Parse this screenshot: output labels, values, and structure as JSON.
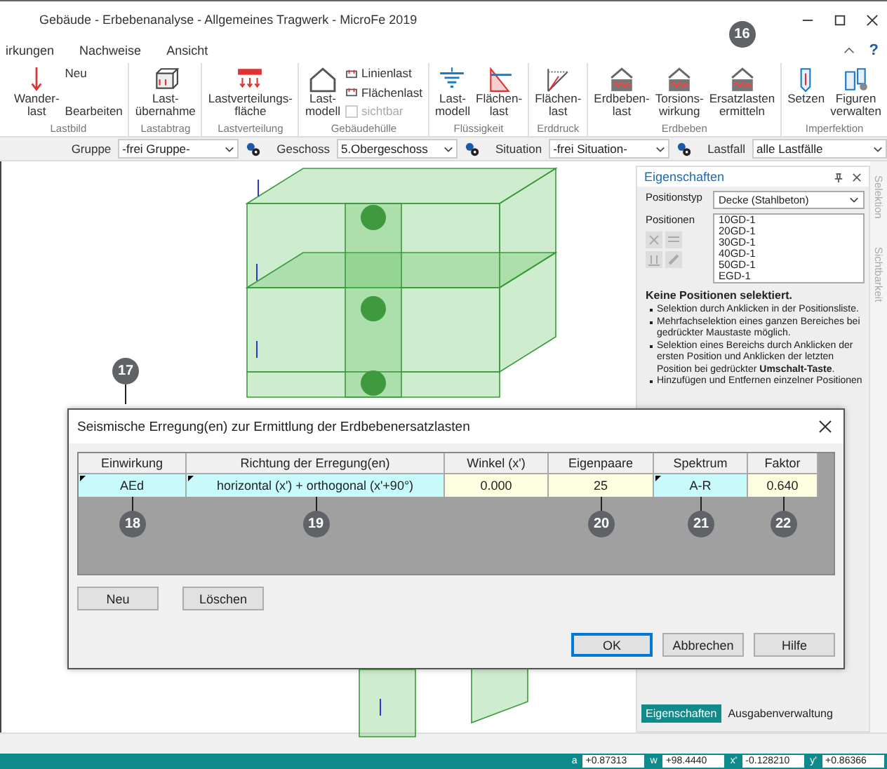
{
  "window": {
    "title": "Gebäude - Erbebenanalyse - Allgemeines Tragwerk - MicroFe 2019"
  },
  "menu": [
    "irkungen",
    "Nachweise",
    "Ansicht"
  ],
  "help": "?",
  "ribbon": [
    {
      "label": "Lastbild",
      "buttons": [
        {
          "kind": "large",
          "label": "Wander-\nlast"
        },
        {
          "kind": "stack",
          "items": [
            {
              "kind": "small",
              "label": "Neu"
            },
            {
              "kind": "small",
              "label": "Bearbeiten"
            }
          ]
        }
      ]
    },
    {
      "label": "Lastabtrag",
      "buttons": [
        {
          "kind": "large",
          "label": "Last-\nübernahme"
        }
      ]
    },
    {
      "label": "Lastverteilung",
      "buttons": [
        {
          "kind": "large",
          "label": "Lastverteilungs-\nfläche"
        }
      ]
    },
    {
      "label": "Gebäudehülle",
      "buttons": [
        {
          "kind": "large",
          "label": "Last-\nmodell"
        },
        {
          "kind": "stack",
          "items": [
            {
              "kind": "tool",
              "label": "Linienlast"
            },
            {
              "kind": "tool",
              "label": "Flächenlast"
            },
            {
              "kind": "check",
              "label": "sichtbar",
              "checked": false,
              "disabled": true
            }
          ]
        }
      ]
    },
    {
      "label": "Flüssigkeit",
      "buttons": [
        {
          "kind": "large",
          "label": "Last-\nmodell"
        },
        {
          "kind": "large",
          "label": "Flächen-\nlast"
        }
      ]
    },
    {
      "label": "Erddruck",
      "buttons": [
        {
          "kind": "large",
          "label": "Flächen-\nlast"
        }
      ]
    },
    {
      "label": "Erdbeben",
      "buttons": [
        {
          "kind": "large",
          "label": "Erdbeben-\nlast"
        },
        {
          "kind": "large",
          "label": "Torsions-\nwirkung"
        },
        {
          "kind": "large",
          "label": "Ersatzlasten\nermitteln",
          "callout": "16"
        }
      ]
    },
    {
      "label": "Imperfektion",
      "buttons": [
        {
          "kind": "large",
          "label": "Setzen"
        },
        {
          "kind": "large",
          "label": "Figuren\nverwalten"
        }
      ]
    }
  ],
  "toolbar": [
    {
      "label": "Gruppe",
      "value": "-frei Gruppe-"
    },
    {
      "label": "Geschoss",
      "value": "5.Obergeschoss"
    },
    {
      "label": "Situation",
      "value": "-frei Situation-"
    },
    {
      "label": "Lastfall",
      "value": "alle Lastfälle"
    }
  ],
  "callout_17": "17",
  "properties": {
    "title": "Eigenschaften",
    "type_label": "Positionstyp",
    "type_value": "Decke (Stahlbeton)",
    "positions_label": "Positionen",
    "positions": [
      "10GD-1",
      "20GD-1",
      "30GD-1",
      "40GD-1",
      "50GD-1",
      "EGD-1"
    ],
    "status": "Keine Positionen selektiert.",
    "hints": [
      "Selektion durch Anklicken in der Positionsliste.",
      "Mehrfachselektion eines ganzen Bereiches bei gedrückter Maustaste möglich.",
      "Selektion eines Bereichs durch Anklicken der ersten Position und Anklicken der letzten Position bei gedrückter **Umschalt-Taste**.",
      "Hinzufügen und Entfernen einzelner Positionen"
    ],
    "tabs": [
      {
        "label": "Eigenschaften",
        "selected": true
      },
      {
        "label": "Ausgabenverwaltung",
        "selected": false
      }
    ]
  },
  "side_tabs": [
    "Selektion",
    "Sichtbarkeit"
  ],
  "dialog": {
    "title": "Seismische Erregung(en) zur Ermittlung der Erdbebenersatzlasten",
    "columns": [
      "Einwirkung",
      "Richtung der Erregung(en)",
      "Winkel (x')",
      "Eigenpaare",
      "Spektrum",
      "Faktor"
    ],
    "cells": [
      {
        "kind": "dropdown",
        "value": "AEd",
        "callout": "18"
      },
      {
        "kind": "dropdown",
        "value": "horizontal (x') + orthogonal (x'+90°)",
        "callout": "19"
      },
      {
        "kind": "input",
        "value": "0.000"
      },
      {
        "kind": "input",
        "value": "25",
        "callout": "20"
      },
      {
        "kind": "dropdown",
        "value": "A-R",
        "callout": "21"
      },
      {
        "kind": "input",
        "value": "0.640",
        "callout": "22"
      }
    ],
    "row_buttons": [
      "Neu",
      "Löschen"
    ],
    "buttons": [
      {
        "label": "OK",
        "default": true
      },
      {
        "label": "Abbrechen",
        "default": false
      },
      {
        "label": "Hilfe",
        "default": false
      }
    ]
  },
  "status_bar": [
    {
      "label": "a",
      "value": "+0.87313"
    },
    {
      "label": "w",
      "value": "+98.4440"
    },
    {
      "label": "x'",
      "value": "-0.128210"
    },
    {
      "label": "y'",
      "value": "+0.86366"
    }
  ]
}
